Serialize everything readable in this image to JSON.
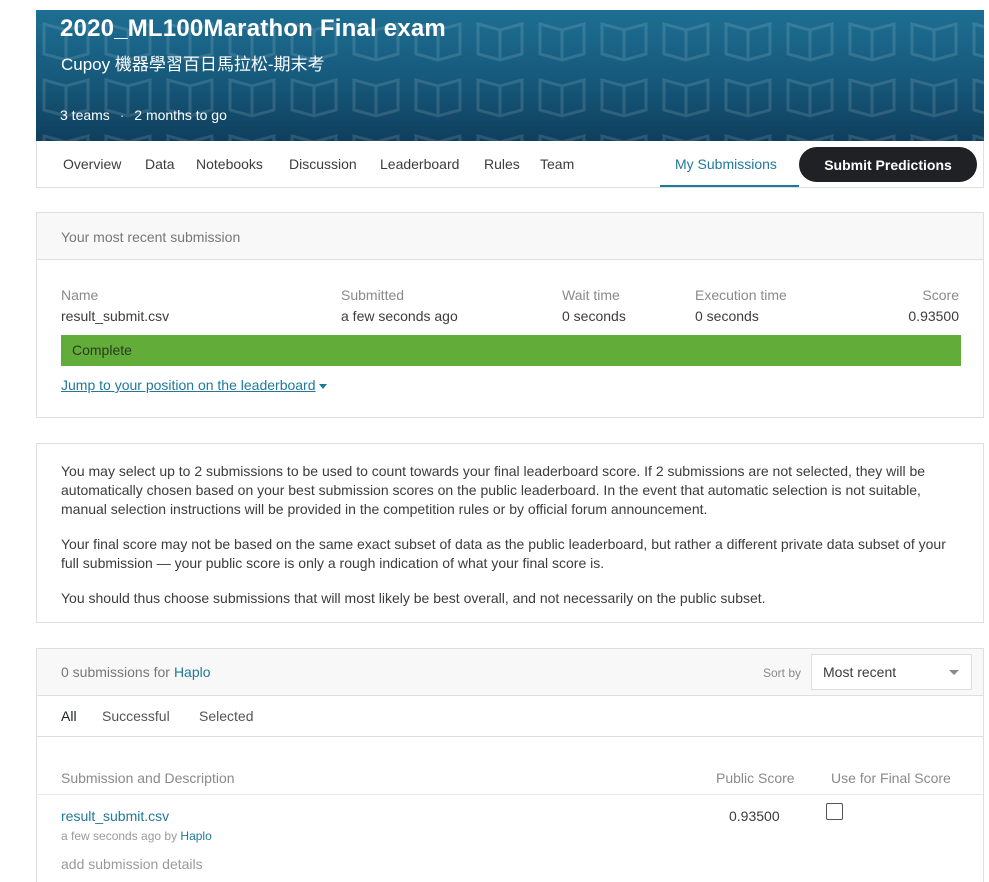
{
  "competition": {
    "title": "2020_ML100Marathon Final exam",
    "subtitle": "Cupoy 機器學習百日馬拉松-期末考",
    "teams": "3 teams",
    "dot": "·",
    "deadline": "2 months to go"
  },
  "tabs": {
    "overview": "Overview",
    "data": "Data",
    "notebooks": "Notebooks",
    "discussion": "Discussion",
    "leaderboard": "Leaderboard",
    "rules": "Rules",
    "team": "Team",
    "my_submissions": "My Submissions",
    "submit": "Submit Predictions"
  },
  "recent": {
    "heading": "Your most recent submission",
    "name_label": "Name",
    "name": "result_submit.csv",
    "submitted_label": "Submitted",
    "submitted": "a few seconds ago",
    "wait_label": "Wait time",
    "wait": "0 seconds",
    "exec_label": "Execution time",
    "exec": "0 seconds",
    "score_label": "Score",
    "score": "0.93500",
    "status": "Complete",
    "status_color": "#62ac3a",
    "jump_link": "Jump to your position on the leaderboard"
  },
  "info": {
    "p1": "You may select up to 2 submissions to be used to count towards your final leaderboard score. If 2 submissions are not selected, they will be automatically chosen based on your best submission scores on the public leaderboard. In the event that automatic selection is not suitable, manual selection instructions will be provided in the competition rules or by official forum announcement.",
    "p2": "Your final score may not be based on the same exact subset of data as the public leaderboard, but rather a different private data subset of your full submission — your public score is only a rough indication of what your final score is.",
    "p3": "You should thus choose submissions that will most likely be best overall, and not necessarily on the public subset."
  },
  "submissions": {
    "count_text": "0 submissions for",
    "user": "Haplo",
    "sort_label": "Sort by",
    "sort_value": "Most recent",
    "filters": [
      "All",
      "Successful",
      "Selected"
    ],
    "col_desc": "Submission and Description",
    "col_public": "Public Score",
    "col_final": "Use for Final Score",
    "rows": [
      {
        "file": "result_submit.csv",
        "time": "a few seconds ago by",
        "by": "Haplo",
        "details": "add submission details",
        "public_score": "0.93500"
      }
    ]
  },
  "colors": {
    "accent": "#20799b",
    "banner": "#16587a",
    "button": "#202124"
  }
}
